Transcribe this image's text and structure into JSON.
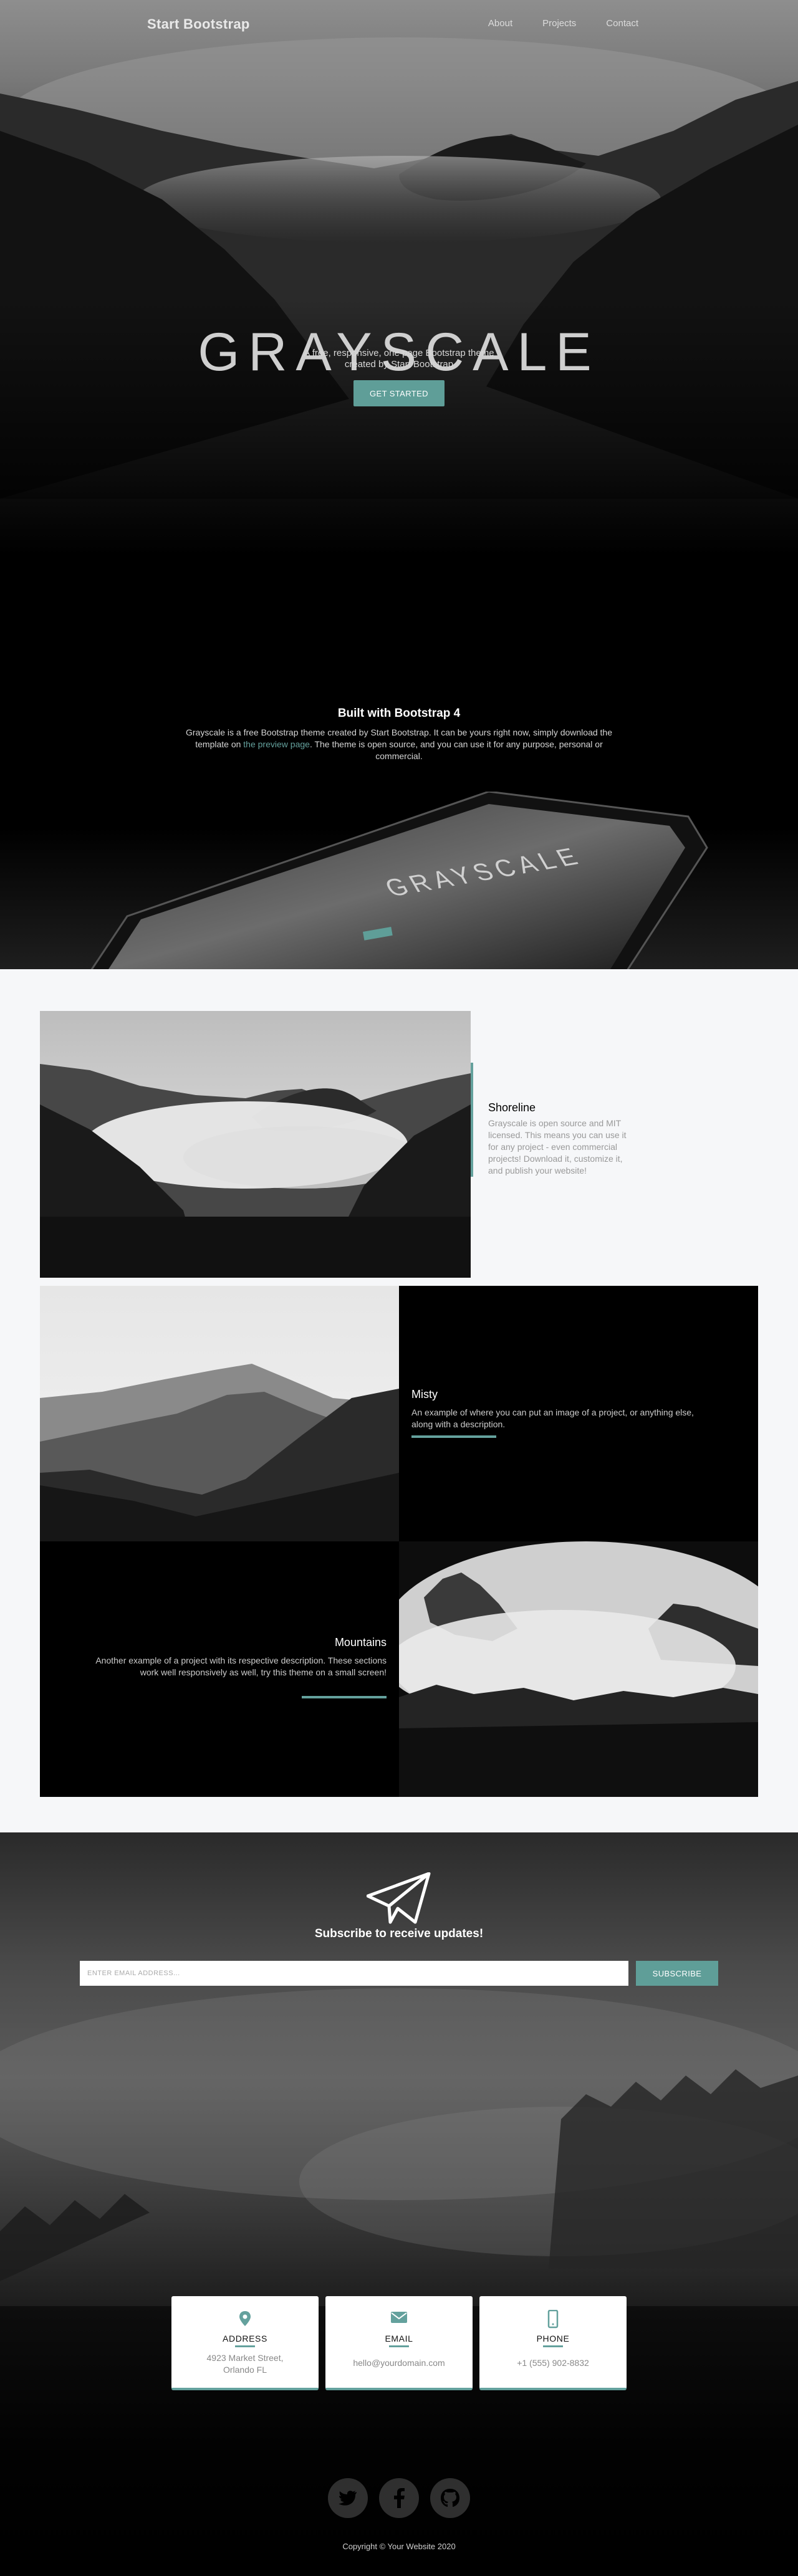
{
  "nav": {
    "brand": "Start Bootstrap",
    "links": [
      "About",
      "Projects",
      "Contact"
    ]
  },
  "hero": {
    "title": "GRAYSCALE",
    "subtitle": "A free, responsive, one page Bootstrap theme created by Start Bootstrap",
    "button": "GET STARTED"
  },
  "about": {
    "title": "Built with Bootstrap 4",
    "text_before": "Grayscale is a free Bootstrap theme created by Start Bootstrap. It can be yours right now, simply download the template on ",
    "link": "the preview page",
    "text_after": ". The theme is open source, and you can use it for any purpose, personal or commercial.",
    "tablet_screen_title": "GRAYSCALE"
  },
  "projects": {
    "featured": {
      "title": "Shoreline",
      "description": "Grayscale is open source and MIT licensed. This means you can use it for any project - even commercial projects! Download it, customize it, and publish your website!"
    },
    "items": [
      {
        "title": "Misty",
        "description": "An example of where you can put an image of a project, or anything else, along with a description."
      },
      {
        "title": "Mountains",
        "description": "Another example of a project with its respective description. These sections work well responsively as well, try this theme on a small screen!"
      }
    ]
  },
  "signup": {
    "title": "Subscribe to receive updates!",
    "placeholder": "Enter email address...",
    "button": "SUBSCRIBE"
  },
  "contact": {
    "address_label": "ADDRESS",
    "address_value": "4923 Market Street, Orlando FL",
    "email_label": "EMAIL",
    "email_value": "hello@yourdomain.com",
    "phone_label": "PHONE",
    "phone_value": "+1 (555) 902-8832"
  },
  "footer": {
    "copyright": "Copyright © Your Website 2020"
  },
  "colors": {
    "accent": "#64a19d",
    "page_bg": "#000000",
    "projects_bg": "#f6f7f9"
  },
  "icons": [
    "twitter-icon",
    "facebook-icon",
    "github-icon",
    "map-marker-icon",
    "envelope-icon",
    "mobile-icon",
    "paper-plane-icon"
  ]
}
